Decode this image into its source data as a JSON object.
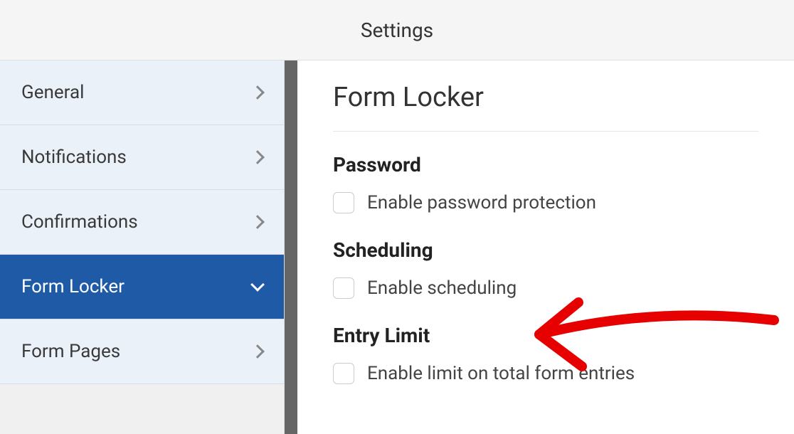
{
  "header": {
    "title": "Settings"
  },
  "sidebar": {
    "items": [
      {
        "label": "General",
        "active": false
      },
      {
        "label": "Notifications",
        "active": false
      },
      {
        "label": "Confirmations",
        "active": false
      },
      {
        "label": "Form Locker",
        "active": true
      },
      {
        "label": "Form Pages",
        "active": false
      }
    ]
  },
  "content": {
    "title": "Form Locker",
    "sections": {
      "password": {
        "heading": "Password",
        "checkbox_label": "Enable password protection"
      },
      "scheduling": {
        "heading": "Scheduling",
        "checkbox_label": "Enable scheduling"
      },
      "entry_limit": {
        "heading": "Entry Limit",
        "checkbox_label": "Enable limit on total form entries"
      }
    }
  }
}
